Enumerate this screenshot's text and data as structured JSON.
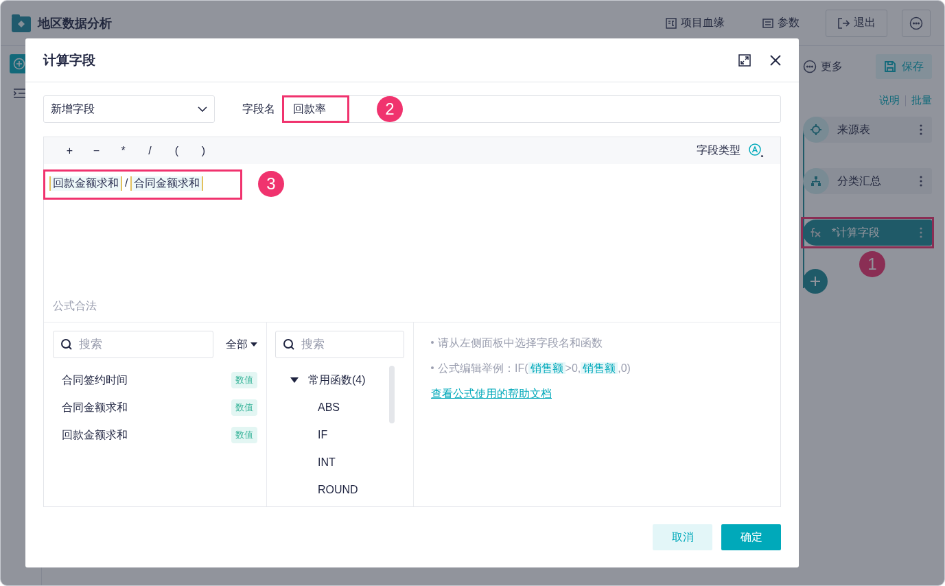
{
  "app": {
    "title": "地区数据分析",
    "header_actions": [
      {
        "kind": "lineage",
        "label": "项目血缘"
      },
      {
        "kind": "params",
        "label": "参数"
      },
      {
        "kind": "exit",
        "label": "退出"
      },
      {
        "kind": "more"
      }
    ],
    "toolbar": {
      "more": "更多",
      "save": "保存"
    },
    "links": [
      "说明",
      "批量"
    ],
    "nodes": [
      {
        "kind": "source",
        "label": "来源表",
        "selected": false
      },
      {
        "kind": "group",
        "label": "分类汇总",
        "selected": false
      },
      {
        "kind": "formula",
        "label": "*计算字段",
        "selected": true,
        "callout": "1"
      }
    ]
  },
  "dialog": {
    "title": "计算字段",
    "mode_select": {
      "value": "新增字段"
    },
    "field_name": {
      "label": "字段名",
      "value": "回款率",
      "callout": "2"
    },
    "operators": [
      "+",
      "−",
      "*",
      "/",
      "(",
      ")"
    ],
    "type_label": "字段类型",
    "formula": {
      "callout": "3",
      "tokens": [
        {
          "kind": "field",
          "text": "回款金额求和"
        },
        {
          "kind": "op",
          "text": "/"
        },
        {
          "kind": "field",
          "text": "合同金额求和"
        }
      ]
    },
    "status": "公式合法",
    "fields": {
      "placeholder": "搜索",
      "filter": "全部",
      "items": [
        {
          "name": "合同签约时间",
          "tag": "数值"
        },
        {
          "name": "合同金额求和",
          "tag": "数值"
        },
        {
          "name": "回款金额求和",
          "tag": "数值"
        }
      ]
    },
    "functions": {
      "placeholder": "搜索",
      "groups": [
        {
          "label": "常用函数(4)",
          "expanded": true,
          "children": [
            {
              "label": "ABS"
            },
            {
              "label": "IF"
            },
            {
              "label": "INT"
            },
            {
              "label": "ROUND"
            }
          ]
        }
      ]
    },
    "help": {
      "lines": [
        [
          {
            "kind": "text",
            "text": "请从左侧面板中选择字段名和函数"
          }
        ],
        [
          {
            "kind": "text",
            "text": "公式编辑举例：IF("
          },
          {
            "kind": "field",
            "text": "销售额"
          },
          {
            "kind": "text",
            "text": ">0,"
          },
          {
            "kind": "field",
            "text": "销售额"
          },
          {
            "kind": "text",
            "text": ",0)"
          }
        ]
      ],
      "link": "查看公式使用的帮助文档"
    },
    "buttons": [
      {
        "kind": "cancel",
        "label": "取消"
      },
      {
        "kind": "confirm",
        "label": "确定"
      }
    ]
  }
}
